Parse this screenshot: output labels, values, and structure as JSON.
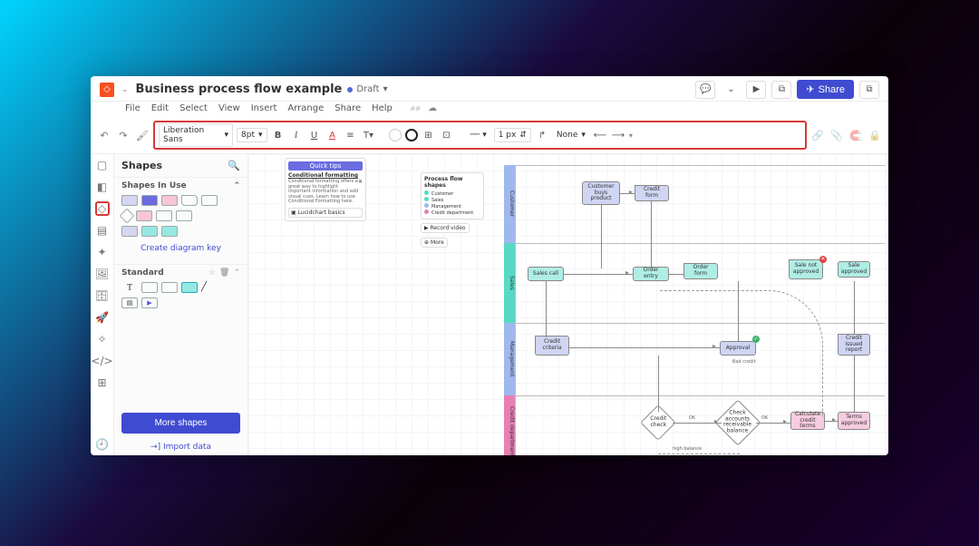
{
  "header": {
    "title": "Business process flow example",
    "status": "Draft",
    "share_label": "Share"
  },
  "menus": [
    "File",
    "Edit",
    "Select",
    "View",
    "Insert",
    "Arrange",
    "Share",
    "Help"
  ],
  "toolbar": {
    "font": "Liberation Sans",
    "size": "8pt",
    "stroke": "1 px",
    "line_style": "None"
  },
  "panel": {
    "title": "Shapes",
    "in_use": "Shapes In Use",
    "create_key": "Create diagram key",
    "standard": "Standard",
    "more": "More shapes",
    "import": "Import data"
  },
  "tips": {
    "quick": "Quick tips",
    "heading": "Conditional formatting",
    "body": "Conditional formatting offers a great way to highlight important information and add visual cues. Learn how to use Conditional Formatting here.",
    "basics": "Lucidchart basics",
    "record": "Record video",
    "more": "More"
  },
  "legend": {
    "title": "Process flow shapes",
    "items": [
      {
        "label": "Customer",
        "color": "#56d9c5"
      },
      {
        "label": "Sales",
        "color": "#56d9c5"
      },
      {
        "label": "Management",
        "color": "#9fb8ee"
      },
      {
        "label": "Credit department",
        "color": "#e87fb2"
      }
    ]
  },
  "lanes": [
    "Customer",
    "Sales",
    "Management",
    "Credit department"
  ],
  "nodes": {
    "cust_buys": "Customer buys product",
    "credit_form": "Credit form",
    "sales_call": "Sales call",
    "order_entry": "Order entry",
    "order_form": "Order form",
    "sale_not": "Sale not approved",
    "sale_app": "Sale approved",
    "credit_crit": "Credit criteria",
    "approval": "Approval",
    "credit_rep": "Credit issued report",
    "credit_check": "Credit check",
    "check_bal": "Check accounts receivable balance",
    "calc_terms": "Calculate credit terms",
    "terms_app": "Terms approved"
  },
  "labels": {
    "ok": "OK",
    "bad": "Bad credit",
    "high": "high balance"
  }
}
